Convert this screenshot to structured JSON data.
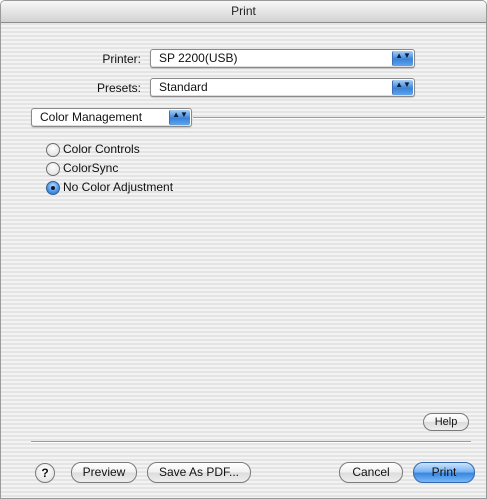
{
  "window": {
    "title": "Print"
  },
  "printer": {
    "label": "Printer:",
    "value": "SP 2200(USB)"
  },
  "presets": {
    "label": "Presets:",
    "value": "Standard"
  },
  "panel": {
    "value": "Color Management"
  },
  "color_options": [
    {
      "label": "Color Controls",
      "selected": false
    },
    {
      "label": "ColorSync",
      "selected": false
    },
    {
      "label": "No Color Adjustment",
      "selected": true
    }
  ],
  "buttons": {
    "help_label": "Help",
    "help_icon_glyph": "?",
    "preview_label": "Preview",
    "save_pdf_label": "Save As PDF...",
    "cancel_label": "Cancel",
    "print_label": "Print"
  },
  "popup_arrow_glyph": "▲▼",
  "accent_color": "#3a86e0"
}
